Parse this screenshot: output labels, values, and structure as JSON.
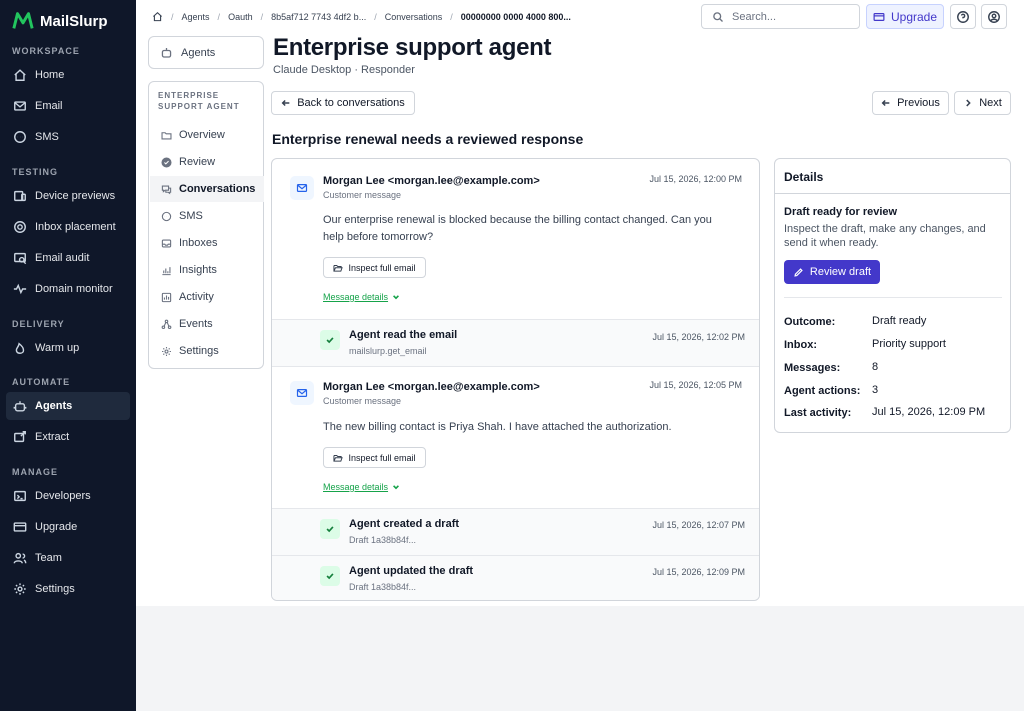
{
  "app": {
    "name": "MailSlurp"
  },
  "sidebar": {
    "sections": [
      {
        "label": "WORKSPACE",
        "items": [
          {
            "label": "Home",
            "icon": "home-icon"
          },
          {
            "label": "Email",
            "icon": "mail-icon"
          },
          {
            "label": "SMS",
            "icon": "sms-icon"
          }
        ]
      },
      {
        "label": "TESTING",
        "items": [
          {
            "label": "Device previews",
            "icon": "device-icon"
          },
          {
            "label": "Inbox placement",
            "icon": "target-icon"
          },
          {
            "label": "Email audit",
            "icon": "audit-icon"
          },
          {
            "label": "Domain monitor",
            "icon": "pulse-icon"
          }
        ]
      },
      {
        "label": "DELIVERY",
        "items": [
          {
            "label": "Warm up",
            "icon": "flame-icon"
          }
        ]
      },
      {
        "label": "AUTOMATE",
        "items": [
          {
            "label": "Agents",
            "icon": "robot-icon",
            "active": true
          },
          {
            "label": "Extract",
            "icon": "extract-icon"
          }
        ]
      },
      {
        "label": "MANAGE",
        "items": [
          {
            "label": "Developers",
            "icon": "terminal-icon"
          },
          {
            "label": "Upgrade",
            "icon": "card-icon"
          },
          {
            "label": "Team",
            "icon": "team-icon"
          },
          {
            "label": "Settings",
            "icon": "gear-icon"
          }
        ]
      }
    ]
  },
  "topbar": {
    "breadcrumbs": [
      "Agents",
      "Oauth",
      "8b5af712 7743 4df2 b...",
      "Conversations",
      "00000000 0000 4000 800..."
    ],
    "search_placeholder": "Search...",
    "upgrade_label": "Upgrade"
  },
  "subnav": {
    "back_label": "Agents",
    "title": "ENTERPRISE SUPPORT AGENT",
    "items": [
      {
        "label": "Overview",
        "icon": "folder-icon"
      },
      {
        "label": "Review",
        "icon": "check-circle-icon"
      },
      {
        "label": "Conversations",
        "icon": "chat-icon",
        "active": true
      },
      {
        "label": "SMS",
        "icon": "sms-icon"
      },
      {
        "label": "Inboxes",
        "icon": "inbox-icon"
      },
      {
        "label": "Insights",
        "icon": "chart-icon"
      },
      {
        "label": "Activity",
        "icon": "activity-icon"
      },
      {
        "label": "Events",
        "icon": "events-icon"
      },
      {
        "label": "Settings",
        "icon": "gear-icon"
      }
    ]
  },
  "page": {
    "title": "Enterprise support agent",
    "subtitle": "Claude Desktop · Responder",
    "back_label": "Back to conversations",
    "prev_label": "Previous",
    "next_label": "Next",
    "conversation_title": "Enterprise renewal needs a reviewed response"
  },
  "thread": {
    "messages": [
      {
        "from": "Morgan Lee <morgan.lee@example.com>",
        "role": "Customer message",
        "time": "Jul 15, 2026, 12:00 PM",
        "body": "Our enterprise renewal is blocked because the billing contact changed. Can you help before tomorrow?",
        "inspect_label": "Inspect full email",
        "details_label": "Message details"
      },
      {
        "from": "Morgan Lee <morgan.lee@example.com>",
        "role": "Customer message",
        "time": "Jul 15, 2026, 12:05 PM",
        "body": "The new billing contact is Priya Shah. I have attached the authorization.",
        "inspect_label": "Inspect full email",
        "details_label": "Message details"
      }
    ],
    "events": [
      {
        "title": "Agent read the email",
        "sub": "mailslurp.get_email",
        "time": "Jul 15, 2026, 12:02 PM"
      },
      {
        "title": "Agent created a draft",
        "sub": "Draft 1a38b84f...",
        "time": "Jul 15, 2026, 12:07 PM"
      },
      {
        "title": "Agent updated the draft",
        "sub": "Draft 1a38b84f...",
        "time": "Jul 15, 2026, 12:09 PM"
      }
    ]
  },
  "details": {
    "heading": "Details",
    "status_title": "Draft ready for review",
    "status_text": "Inspect the draft, make any changes, and send it when ready.",
    "review_label": "Review draft",
    "rows": [
      {
        "key": "Outcome:",
        "value": "Draft ready"
      },
      {
        "key": "Inbox:",
        "value": "Priority support"
      },
      {
        "key": "Messages:",
        "value": "8"
      },
      {
        "key": "Agent actions:",
        "value": "3"
      },
      {
        "key": "Last activity:",
        "value": "Jul 15, 2026, 12:09 PM"
      }
    ]
  },
  "colors": {
    "sidebar_bg": "#0f1729",
    "accent": "#4338ca",
    "success": "#16a34a",
    "logo_green": "#22c55e"
  }
}
